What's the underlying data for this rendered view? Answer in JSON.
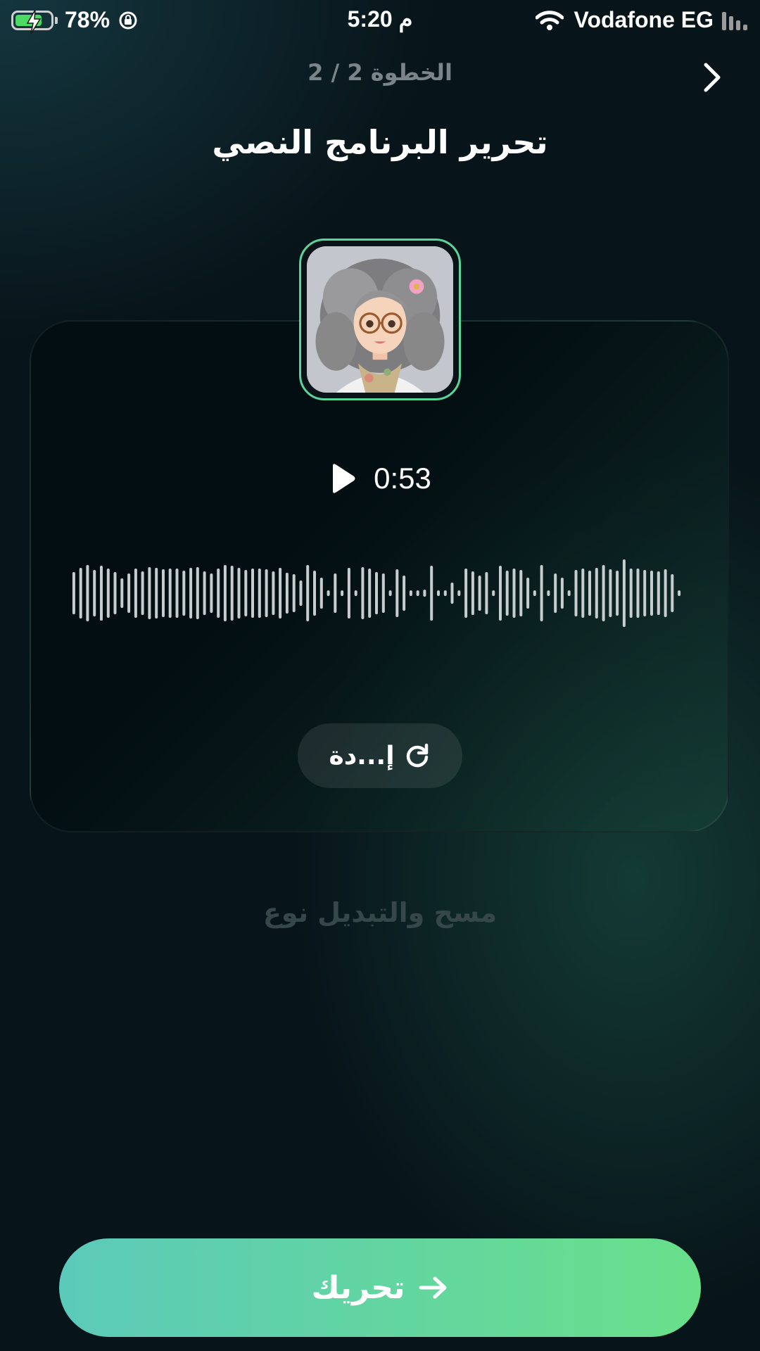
{
  "status_bar": {
    "battery_percent": "78%",
    "battery_level": 0.78,
    "time": "5:20 م",
    "carrier": "Vodafone EG",
    "icons": [
      "battery-charging-icon",
      "rotation-lock-icon",
      "wifi-icon",
      "signal-icon"
    ]
  },
  "header": {
    "step": "الخطوة 2 / 2",
    "title": "تحرير البرنامج النصي"
  },
  "player": {
    "duration": "0:53",
    "redo_label": "إ...دة"
  },
  "footer": {
    "clear_label": "مسح والتبديل نوع",
    "animate_label": "تحريك"
  },
  "colors": {
    "accent_green": "#59d49a",
    "cta_gradient_start": "#5ccab9",
    "cta_gradient_end": "#68e08a",
    "background": "#071419"
  }
}
